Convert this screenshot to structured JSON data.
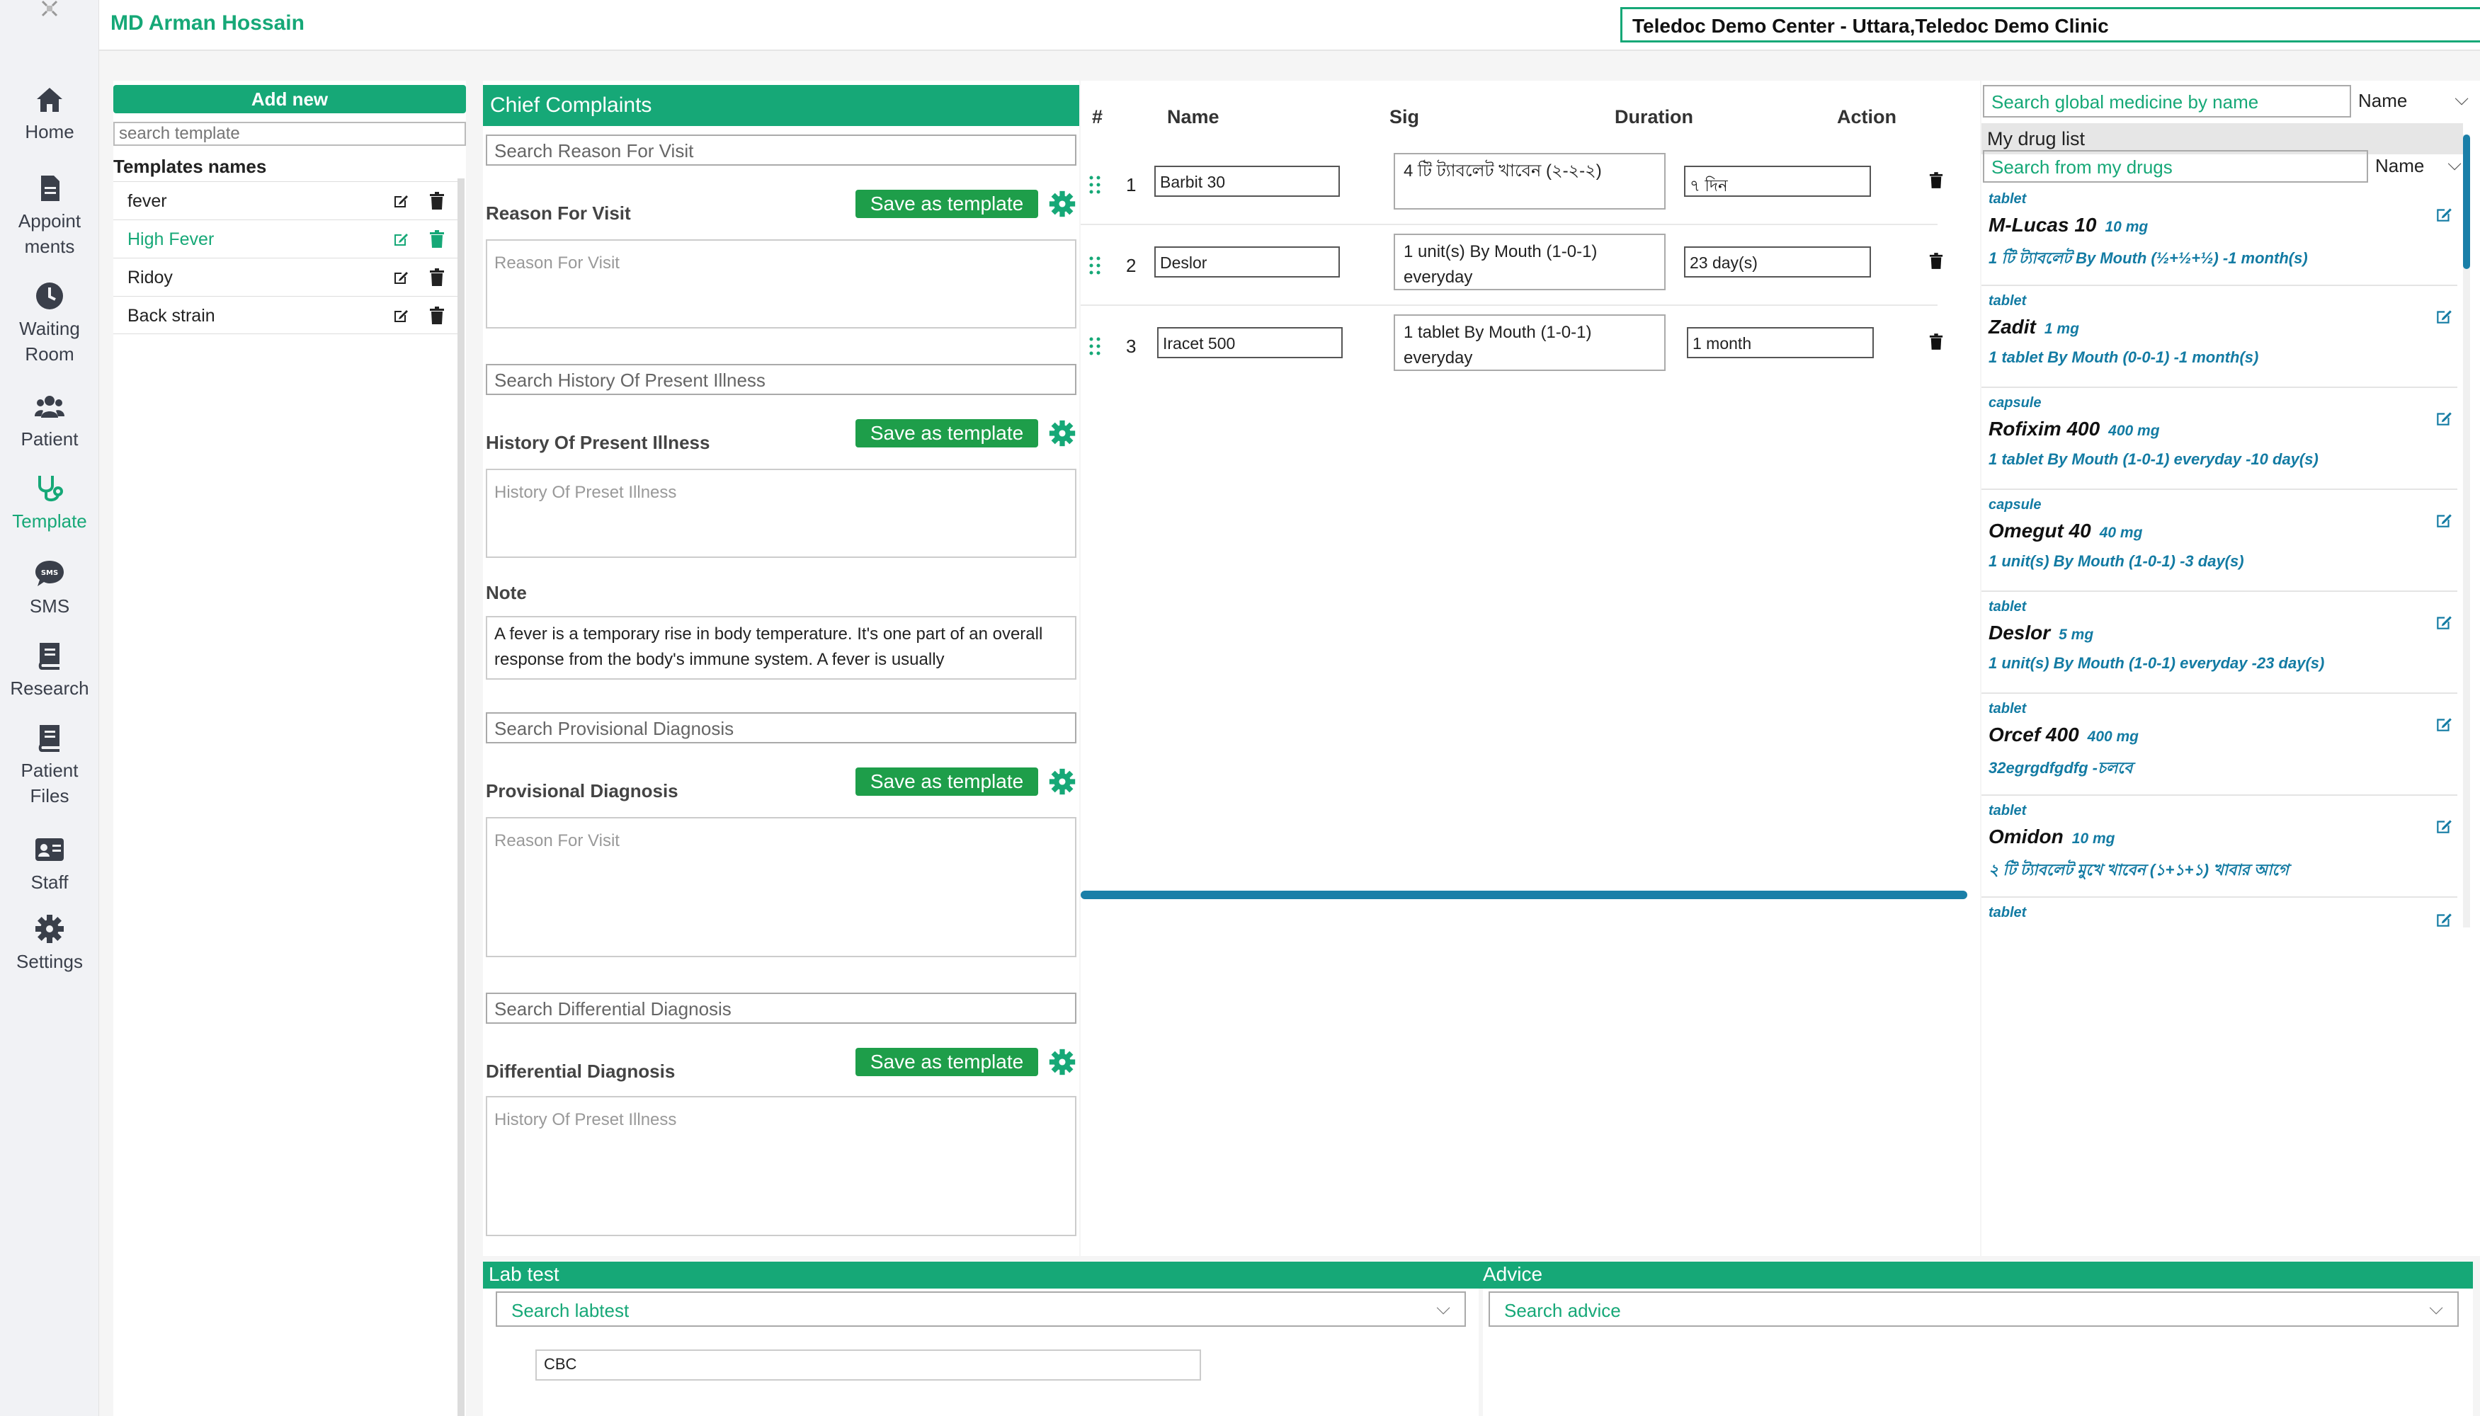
{
  "doctor_name": "MD Arman Hossain",
  "clinic": "Teledoc Demo Center - Uttara,Teledoc Demo Clinic",
  "colors": {
    "accent": "#16a877",
    "button": "#1e9e4a",
    "link": "#137ba3"
  },
  "nav": [
    {
      "label": "Home",
      "icon": "home-icon"
    },
    {
      "label": "Appoint ments",
      "icon": "document-icon"
    },
    {
      "label": "Waiting Room",
      "icon": "clock-icon"
    },
    {
      "label": "Patient",
      "icon": "users-icon"
    },
    {
      "label": "Template",
      "icon": "stethoscope-icon",
      "active": true
    },
    {
      "label": "SMS",
      "icon": "sms-icon"
    },
    {
      "label": "Research",
      "icon": "book-icon"
    },
    {
      "label": "Patient Files",
      "icon": "book-icon"
    },
    {
      "label": "Staff",
      "icon": "id-card-icon"
    },
    {
      "label": "Settings",
      "icon": "gear-icon"
    }
  ],
  "templates": {
    "add_new": "Add new",
    "search_placeholder": "search template",
    "title": "Templates names",
    "items": [
      "fever",
      "High Fever",
      "Ridoy",
      "Back strain"
    ]
  },
  "complaints": {
    "header": "Chief Complaints",
    "save_label": "Save as template",
    "sections": {
      "reason": {
        "search": "Search Reason For Visit",
        "label": "Reason For Visit",
        "placeholder": "Reason For Visit"
      },
      "history": {
        "search": "Search History Of Present Illness",
        "label": "History Of Present Illness",
        "placeholder": "History Of Preset Illness"
      },
      "note": {
        "label": "Note",
        "value": "A fever is a temporary rise in body temperature. It's one part of an overall response from the body's immune system. A fever is usually"
      },
      "provisional": {
        "search": "Search Provisional Diagnosis",
        "label": "Provisional Diagnosis",
        "placeholder": "Reason For Visit"
      },
      "differential": {
        "search": "Search Differential Diagnosis",
        "label": "Differential Diagnosis",
        "placeholder": "History Of Preset Illness"
      }
    }
  },
  "medicine_table": {
    "headers": {
      "num": "#",
      "name": "Name",
      "sig": "Sig",
      "duration": "Duration",
      "action": "Action"
    },
    "rows": [
      {
        "num": "1",
        "name": "Barbit 30",
        "sig": "4 টি ট্যাবলেট খাবেন (২-২-২)",
        "duration": "৭ দিন"
      },
      {
        "num": "2",
        "name": "Deslor",
        "sig": "1 unit(s) By Mouth (1-0-1) everyday",
        "duration": "23 day(s)"
      },
      {
        "num": "3",
        "name": "Iracet 500",
        "sig": "1 tablet By Mouth (1-0-1) everyday",
        "duration": "1 month"
      }
    ]
  },
  "drug_panel": {
    "global_search_placeholder": "Search global medicine by name",
    "global_sort": "Name",
    "my_list_title": "My drug list",
    "my_search_placeholder": "Search from my drugs",
    "my_sort": "Name",
    "items": [
      {
        "form": "tablet",
        "name": "M-Lucas 10",
        "strength": "10 mg",
        "sig": "1 টি ট্যাবলেট By Mouth (½+½+½) -1 month(s)"
      },
      {
        "form": "tablet",
        "name": "Zadit",
        "strength": "1 mg",
        "sig": "1 tablet By Mouth (0-0-1) -1 month(s)"
      },
      {
        "form": "capsule",
        "name": "Rofixim 400",
        "strength": "400 mg",
        "sig": "1 tablet By Mouth (1-0-1) everyday -10 day(s)"
      },
      {
        "form": "capsule",
        "name": "Omegut 40",
        "strength": "40 mg",
        "sig": "1 unit(s) By Mouth (1-0-1) -3 day(s)"
      },
      {
        "form": "tablet",
        "name": "Deslor",
        "strength": "5 mg",
        "sig": "1 unit(s) By Mouth (1-0-1) everyday -23 day(s)"
      },
      {
        "form": "tablet",
        "name": "Orcef 400",
        "strength": "400 mg",
        "sig": "32egrgdfgdfg -চলবে"
      },
      {
        "form": "tablet",
        "name": "Omidon",
        "strength": "10 mg",
        "sig": "২ টি ট্যাবলেট মুখে খাবেন (১+১+১) খাবার আগে"
      },
      {
        "form": "tablet",
        "name": "",
        "strength": "",
        "sig": ""
      }
    ]
  },
  "lab": {
    "title": "Lab test",
    "search_placeholder": "Search labtest",
    "first_item": "CBC"
  },
  "advice": {
    "title": "Advice",
    "search_placeholder": "Search advice"
  }
}
